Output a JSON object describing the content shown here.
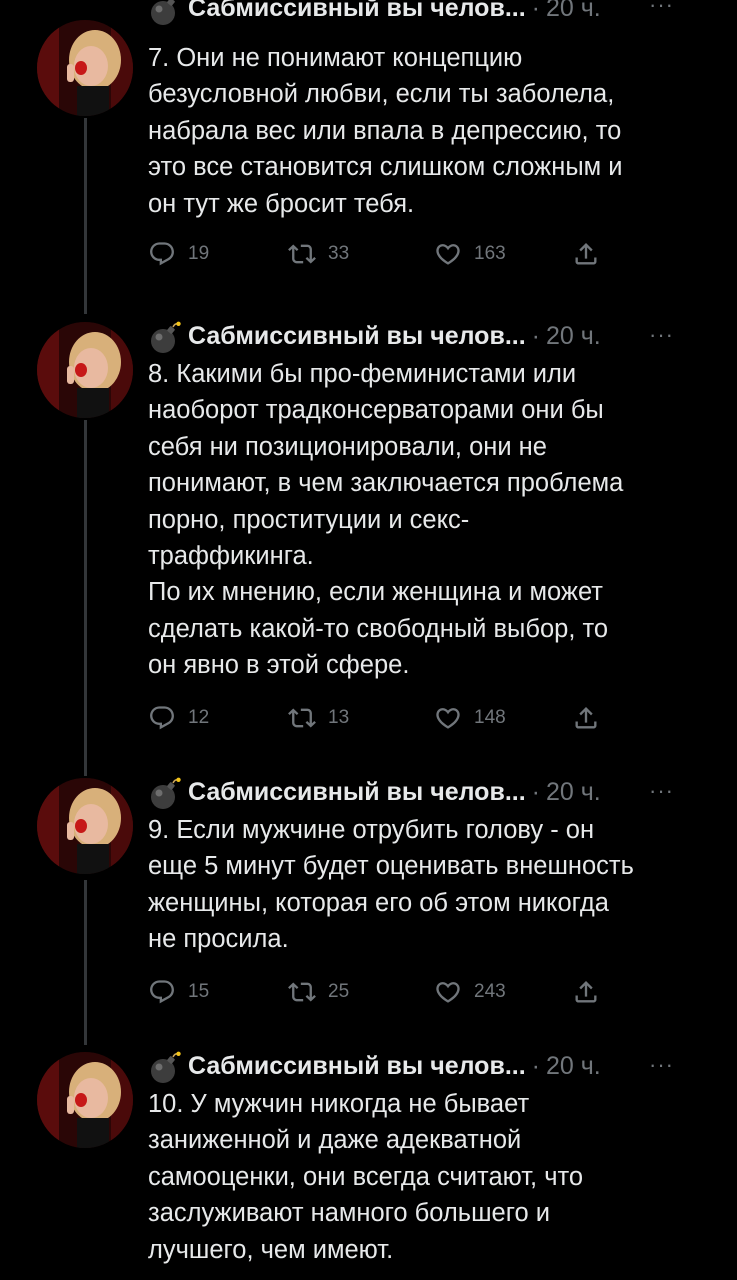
{
  "tweets": [
    {
      "author": "Сабмиссивный вы челов...",
      "time": "20 ч.",
      "text": "7. Они не понимают концепцию\nбезусловной любви, если ты заболела,\nнабрала вес или впала в депрессию, то\nэто все становится слишком сложным и\nон тут же бросит тебя.",
      "replies": "19",
      "retweets": "33",
      "likes": "163"
    },
    {
      "author": "Сабмиссивный вы челов...",
      "time": "20 ч.",
      "text": "8. Какими бы про-феминистами или\nнаоборот традконсерваторами они бы\nсебя ни позиционировали, они не\nпонимают, в чем заключается проблема\nпорно, проституции и секс-\nтраффикинга.\nПо их мнению, если женщина и может\nсделать какой-то свободный выбор, то\nон явно в этой сфере.",
      "replies": "12",
      "retweets": "13",
      "likes": "148"
    },
    {
      "author": "Сабмиссивный вы челов...",
      "time": "20 ч.",
      "text": "9. Если мужчине отрубить голову - он\nеще 5 минут будет оценивать внешность\nженщины, которая его об этом никогда\nне просила.",
      "replies": "15",
      "retweets": "25",
      "likes": "243"
    },
    {
      "author": "Сабмиссивный вы челов...",
      "time": "20 ч.",
      "text": "10. У мужчин никогда не бывает\nзаниженной и даже адекватной\nсамооценки, они всегда считают, что\nзаслуживают намного большего и\nлучшего, чем имеют."
    }
  ],
  "more_icon": "more-horizontal-icon",
  "avatar_caption": "Megnwtole.",
  "colors": {
    "background": "#000000",
    "text": "#e7e9ea",
    "muted": "#71767b",
    "thread_line": "#333639"
  }
}
